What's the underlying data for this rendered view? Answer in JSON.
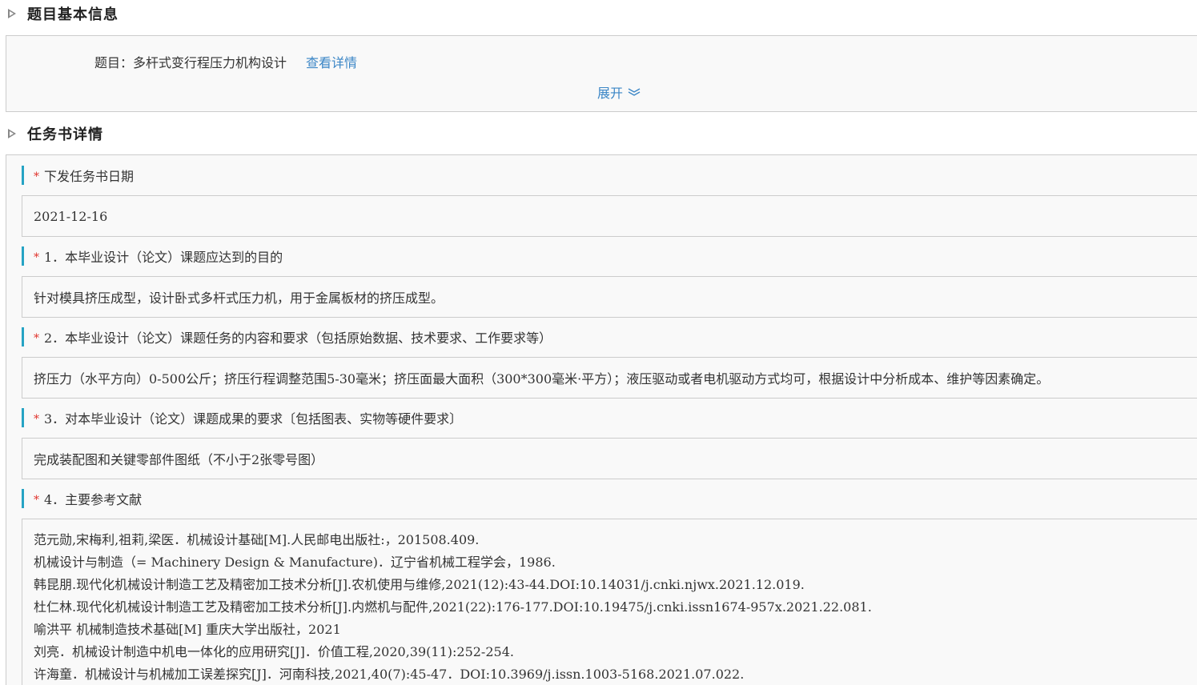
{
  "basic_info": {
    "title": "题目基本信息",
    "topic_label": "题目：",
    "topic_value": "多杆式变行程压力机构设计",
    "view_details": "查看详情",
    "expand": "展开",
    "expand_icon": "chevron-double-down-icon"
  },
  "task_book": {
    "title": "任务书详情",
    "required_mark": "*",
    "issue_date_label": "下发任务书日期",
    "issue_date_value": "2021-12-16",
    "purpose_label": "1．本毕业设计（论文）课题应达到的目的",
    "purpose_value": "针对模具挤压成型，设计卧式多杆式压力机，用于金属板材的挤压成型。",
    "content_label": "2．本毕业设计（论文）课题任务的内容和要求（包括原始数据、技术要求、工作要求等）",
    "content_value": "挤压力（水平方向）0-500公斤；挤压行程调整范围5-30毫米；挤压面最大面积（300*300毫米·平方）；液压驱动或者电机驱动方式均可，根据设计中分析成本、维护等因素确定。",
    "results_label": "3．对本毕业设计（论文）课题成果的要求〔包括图表、实物等硬件要求〕",
    "results_value": "完成装配图和关键零部件图纸（不小于2张零号图）",
    "refs_label": "4．主要参考文献",
    "refs": [
      "范元勋,宋梅利,祖莉,梁医．机械设计基础[M].人民邮电出版社:，201508.409.",
      "机械设计与制造（= Machinery Design & Manufacture)．辽宁省机械工程学会，1986.",
      "韩昆朋.现代化机械设计制造工艺及精密加工技术分析[J].农机使用与维修,2021(12):43-44.DOI:10.14031/j.cnki.njwx.2021.12.019.",
      "杜仁林.现代化机械设计制造工艺及精密加工技术分析[J].内燃机与配件,2021(22):176-177.DOI:10.19475/j.cnki.issn1674-957x.2021.22.081.",
      "喻洪平 机械制造技术基础[M] 重庆大学出版社，2021",
      "刘亮．机械设计制造中机电一体化的应用研究[J]．价值工程,2020,39(11):252-254.",
      "许海童．机械设计与机械加工误差探究[J]．河南科技,2021,40(7):45-47．DOI:10.3969/j.issn.1003-5168.2021.07.022."
    ]
  },
  "colors": {
    "accent_link": "#3b86c6",
    "label_bar": "#26a3c4",
    "required": "#e0322b",
    "panel_bg": "#f9f9f9",
    "border": "#cccccc"
  }
}
